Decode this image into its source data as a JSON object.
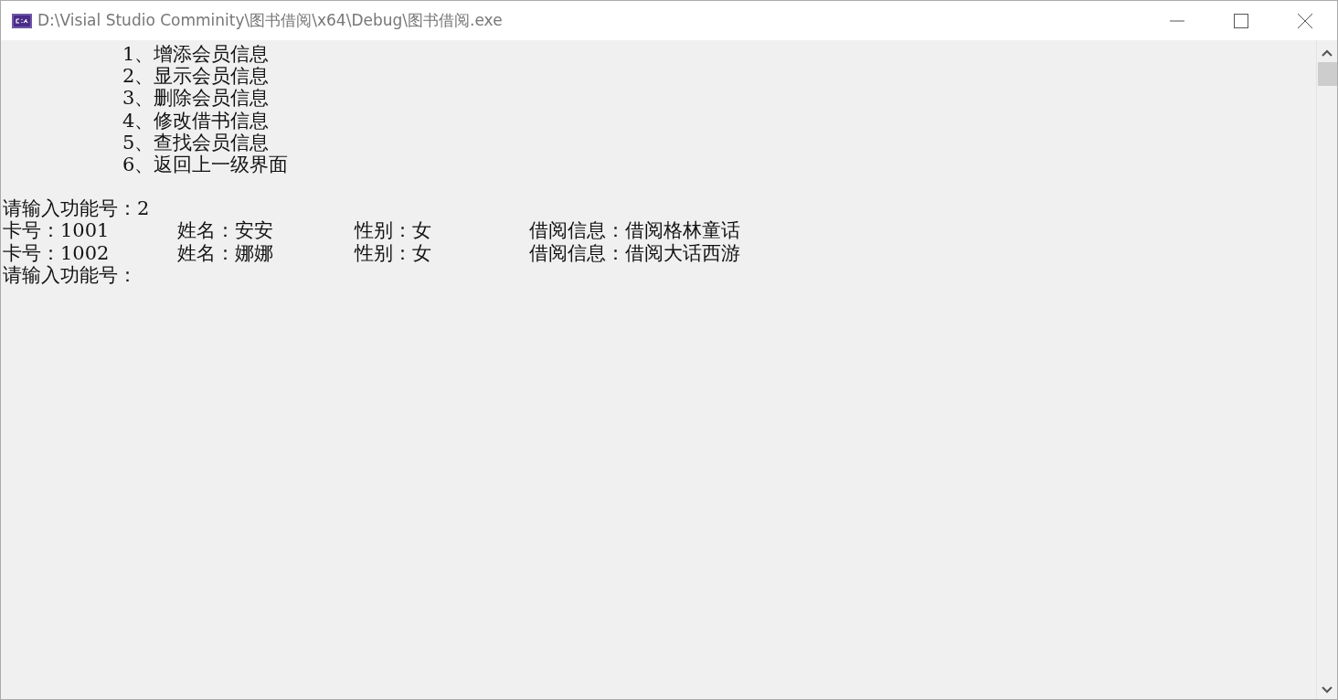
{
  "window": {
    "title": "D:\\Visial Studio Comminity\\图书借阅\\x64\\Debug\\图书借阅.exe"
  },
  "menu": [
    "1、增添会员信息",
    "2、显示会员信息",
    "3、删除会员信息",
    "4、修改借书信息",
    "5、查找会员信息",
    "6、返回上一级界面"
  ],
  "prompt": "请输入功能号：2",
  "records": [
    {
      "card": "卡号：1001",
      "name": "姓名：安安",
      "sex": "性别：女",
      "info": "借阅信息：借阅格林童话"
    },
    {
      "card": "卡号：1002",
      "name": "姓名：娜娜",
      "sex": "性别：女",
      "info": "借阅信息：借阅大话西游"
    }
  ],
  "next_prompt": "请输入功能号："
}
